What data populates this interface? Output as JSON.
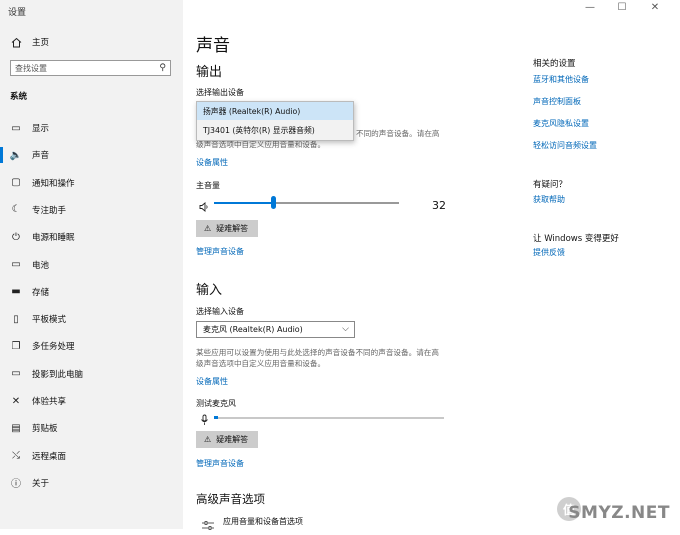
{
  "window": {
    "title": "设置",
    "minimize": "—",
    "maximize": "☐",
    "close": "✕"
  },
  "sidebar": {
    "home": "主页",
    "search_placeholder": "查找设置",
    "section": "系统",
    "items": [
      {
        "label": "显示",
        "icon": "display-icon"
      },
      {
        "label": "声音",
        "icon": "speaker-icon",
        "active": true
      },
      {
        "label": "通知和操作",
        "icon": "notification-icon"
      },
      {
        "label": "专注助手",
        "icon": "moon-icon"
      },
      {
        "label": "电源和睡眠",
        "icon": "power-icon"
      },
      {
        "label": "电池",
        "icon": "battery-icon"
      },
      {
        "label": "存储",
        "icon": "storage-icon"
      },
      {
        "label": "平板模式",
        "icon": "tablet-icon"
      },
      {
        "label": "多任务处理",
        "icon": "multitask-icon"
      },
      {
        "label": "投影到此电脑",
        "icon": "project-icon"
      },
      {
        "label": "体验共享",
        "icon": "share-icon"
      },
      {
        "label": "剪贴板",
        "icon": "clipboard-icon"
      },
      {
        "label": "远程桌面",
        "icon": "remote-desktop-icon"
      },
      {
        "label": "关于",
        "icon": "info-icon"
      }
    ]
  },
  "main": {
    "title": "声音",
    "output": {
      "heading": "输出",
      "select_label": "选择输出设备",
      "options": [
        "扬声器 (Realtek(R) Audio)",
        "TJ3401 (英特尔(R) 显示器音频)"
      ],
      "selected_index": 0,
      "description_tail": "不同的声音设备。请在高",
      "description_line2": "级声音选项中自定义应用音量和设备。",
      "device_properties": "设备属性",
      "master_volume_label": "主音量",
      "volume_value": "32",
      "volume_fraction": 0.32,
      "troubleshoot": "疑难解答",
      "manage_devices": "管理声音设备"
    },
    "input": {
      "heading": "输入",
      "select_label": "选择输入设备",
      "selected_device": "麦克风 (Realtek(R) Audio)",
      "description_line1": "某些应用可以设置为使用与此处选择的声音设备不同的声音设备。请在高",
      "description_line2": "级声音选项中自定义应用音量和设备。",
      "device_properties": "设备属性",
      "test_mic_label": "测试麦克风",
      "troubleshoot": "疑难解答",
      "manage_devices": "管理声音设备"
    },
    "advanced": {
      "heading": "高级声音选项",
      "app_volume": "应用音量和设备首选项"
    }
  },
  "right": {
    "related_heading": "相关的设置",
    "related_links": [
      "蓝牙和其他设备",
      "声音控制面板",
      "麦克风隐私设置",
      "轻松访问音频设置"
    ],
    "help_heading": "有疑问？",
    "help_link": "获取帮助",
    "improve_heading": "让 Windows 变得更好",
    "improve_link": "提供反馈"
  },
  "watermark": {
    "text": "SMYZ.NET",
    "logo": "值"
  },
  "colors": {
    "accent": "#0078d7",
    "link": "#0067b8",
    "sidebar_bg": "#f2f2f2"
  }
}
